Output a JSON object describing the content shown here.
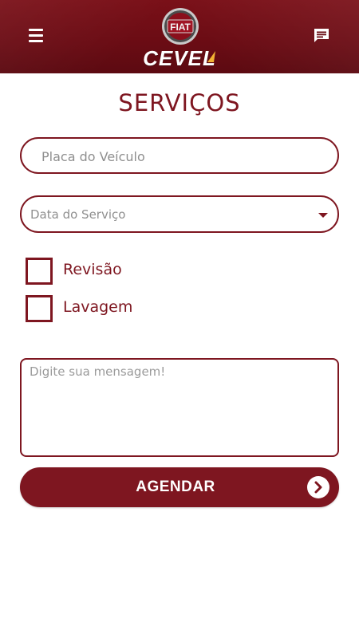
{
  "header": {
    "brand_emblem_text": "FIAT",
    "brand_name": "CEVEL",
    "menu_icon": "hamburger-menu-icon",
    "message_icon": "chat-message-icon"
  },
  "page": {
    "title": "SERVIÇOS"
  },
  "form": {
    "plate": {
      "placeholder": "Placa do Veículo",
      "value": ""
    },
    "date": {
      "placeholder": "Data do Serviço"
    },
    "options": [
      {
        "label": "Revisão",
        "checked": false
      },
      {
        "label": "Lavagem",
        "checked": false
      }
    ],
    "message": {
      "placeholder": "Digite sua mensagem!",
      "value": ""
    },
    "submit": {
      "label": "AGENDAR",
      "icon": "chevron-right-circle-icon"
    }
  },
  "colors": {
    "primary": "#7e1620",
    "header_bg": "#6a0c14",
    "placeholder": "#8f8f8f"
  }
}
